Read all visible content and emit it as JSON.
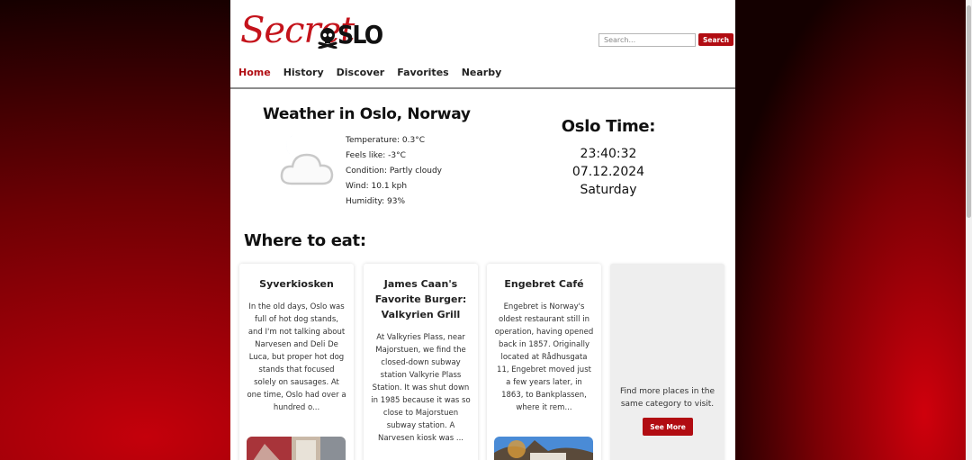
{
  "header": {
    "logo_script": "Secret",
    "logo_block": "SLO",
    "search_placeholder": "Search...",
    "search_button": "Search"
  },
  "nav": {
    "items": [
      {
        "label": "Home",
        "active": true
      },
      {
        "label": "History"
      },
      {
        "label": "Discover"
      },
      {
        "label": "Favorites"
      },
      {
        "label": "Nearby"
      }
    ]
  },
  "weather": {
    "title": "Weather in Oslo, Norway",
    "icon": "partly-cloudy-night-icon",
    "temperature": "Temperature: 0.3°C",
    "feels_like": "Feels like: -3°C",
    "condition": "Condition: Partly cloudy",
    "wind": "Wind: 10.1 kph",
    "humidity": "Humidity: 93%"
  },
  "time": {
    "title": "Oslo Time:",
    "clock": "23:40:32",
    "date": "07.12.2024",
    "weekday": "Saturday"
  },
  "eat": {
    "title": "Where to eat:",
    "cards": [
      {
        "title": "Syverkiosken",
        "text": "In the old days, Oslo was full of hot dog stands, and I'm not talking about Narvesen and Deli De Luca, but proper hot dog stands that focused solely on sausages. At one time, Oslo had over a hundred o..."
      },
      {
        "title": "James Caan's Favorite Burger: Valkyrien Grill",
        "text": "At Valkyries Plass, near Majorstuen, we find the closed-down subway station Valkyrie Plass Station. It was shut down in 1985 because it was so close to Majorstuen subway station. A Narvesen kiosk was ..."
      },
      {
        "title": "Engebret Café",
        "text": "Engebret is Norway's oldest restaurant still in operation, having opened back in 1857. Originally located at Rådhusgata 11, Engebret moved just a few years later, in 1863, to Bankplassen, where it rem..."
      }
    ],
    "more_text": "Find more places in the same category to visit.",
    "more_button": "See More"
  },
  "colors": {
    "accent": "#b10c12",
    "logo_red": "#c4131b"
  }
}
